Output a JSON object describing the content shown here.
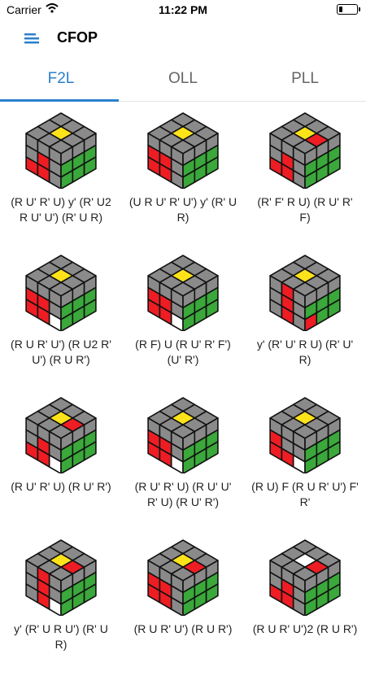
{
  "status": {
    "carrier": "Carrier",
    "time": "11:22 PM"
  },
  "header": {
    "title": "CFOP"
  },
  "tabs": [
    {
      "label": "F2L"
    },
    {
      "label": "OLL"
    },
    {
      "label": "PLL"
    }
  ],
  "colors": {
    "accent": "#2b7fcc",
    "gray": "#8a8a8a",
    "red": "#ee1d23",
    "green": "#3aa83a",
    "yellow": "#ffe31a",
    "white": "#ffffff"
  },
  "cards": [
    {
      "alg": "(R U' R' U) y' (R' U2 R U' U') (R' U R)",
      "cube": {
        "top": [
          "g",
          "g",
          "g",
          "g",
          "y",
          "g",
          "g",
          "g",
          "g"
        ],
        "left": [
          "g",
          "g",
          "g",
          "g",
          "r",
          "g",
          "r",
          "r",
          "g"
        ],
        "right": [
          "g",
          "g",
          "g",
          "g",
          "g",
          "g",
          "g",
          "g",
          "g"
        ]
      }
    },
    {
      "alg": "(U R U' R' U') y' (R' U R)",
      "cube": {
        "top": [
          "g",
          "g",
          "g",
          "g",
          "y",
          "g",
          "g",
          "g",
          "g"
        ],
        "left": [
          "g",
          "g",
          "g",
          "r",
          "r",
          "g",
          "r",
          "r",
          "g"
        ],
        "right": [
          "g",
          "g",
          "g",
          "g",
          "g",
          "g",
          "g",
          "g",
          "g"
        ]
      }
    },
    {
      "alg": "(R' F' R U) (R U' R' F)",
      "cube": {
        "top": [
          "g",
          "g",
          "g",
          "g",
          "y",
          "r",
          "g",
          "g",
          "g"
        ],
        "left": [
          "g",
          "g",
          "g",
          "g",
          "r",
          "g",
          "r",
          "r",
          "g"
        ],
        "right": [
          "g",
          "g",
          "g",
          "g",
          "g",
          "g",
          "g",
          "g",
          "g"
        ]
      }
    },
    {
      "alg": "(R U R' U') (R U2 R' U') (R U R')",
      "cube": {
        "top": [
          "g",
          "g",
          "g",
          "g",
          "y",
          "g",
          "g",
          "g",
          "g"
        ],
        "left": [
          "g",
          "g",
          "g",
          "r",
          "r",
          "g",
          "r",
          "r",
          "w"
        ],
        "right": [
          "g",
          "g",
          "g",
          "g",
          "g",
          "g",
          "g",
          "g",
          "g"
        ]
      }
    },
    {
      "alg": "(R F) U (R U' R' F') (U' R')",
      "cube": {
        "top": [
          "g",
          "g",
          "g",
          "g",
          "y",
          "g",
          "g",
          "g",
          "g"
        ],
        "left": [
          "g",
          "g",
          "g",
          "r",
          "r",
          "g",
          "r",
          "r",
          "w"
        ],
        "right": [
          "g",
          "g",
          "g",
          "g",
          "g",
          "g",
          "g",
          "g",
          "g"
        ]
      }
    },
    {
      "alg": "y' (R' U' R U) (R' U' R)",
      "cube": {
        "top": [
          "g",
          "g",
          "g",
          "g",
          "y",
          "g",
          "g",
          "g",
          "g"
        ],
        "left": [
          "g",
          "r",
          "g",
          "g",
          "r",
          "g",
          "g",
          "r",
          "g"
        ],
        "right": [
          "g",
          "g",
          "g",
          "g",
          "g",
          "g",
          "r",
          "g",
          "g"
        ]
      }
    },
    {
      "alg": "(R U' R' U) (R U' R')",
      "cube": {
        "top": [
          "g",
          "g",
          "g",
          "g",
          "y",
          "r",
          "g",
          "g",
          "g"
        ],
        "left": [
          "g",
          "g",
          "g",
          "g",
          "r",
          "g",
          "r",
          "r",
          "w"
        ],
        "right": [
          "g",
          "g",
          "g",
          "g",
          "g",
          "g",
          "g",
          "g",
          "g"
        ]
      }
    },
    {
      "alg": "(R U' R' U) (R U' U' R' U) (R U' R')",
      "cube": {
        "top": [
          "g",
          "g",
          "g",
          "g",
          "y",
          "g",
          "g",
          "g",
          "g"
        ],
        "left": [
          "g",
          "g",
          "g",
          "r",
          "r",
          "g",
          "r",
          "r",
          "w"
        ],
        "right": [
          "g",
          "g",
          "g",
          "g",
          "g",
          "g",
          "g",
          "g",
          "g"
        ]
      }
    },
    {
      "alg": "(R U) F (R U R' U') F' R'",
      "cube": {
        "top": [
          "g",
          "g",
          "g",
          "g",
          "y",
          "g",
          "g",
          "g",
          "g"
        ],
        "left": [
          "g",
          "g",
          "g",
          "r",
          "g",
          "g",
          "r",
          "r",
          "w"
        ],
        "right": [
          "g",
          "g",
          "g",
          "g",
          "g",
          "g",
          "g",
          "g",
          "g"
        ]
      }
    },
    {
      "alg": "y' (R' U R U') (R' U R)",
      "cube": {
        "top": [
          "g",
          "g",
          "g",
          "g",
          "y",
          "r",
          "g",
          "g",
          "g"
        ],
        "left": [
          "g",
          "r",
          "g",
          "g",
          "r",
          "g",
          "g",
          "r",
          "w"
        ],
        "right": [
          "g",
          "g",
          "g",
          "g",
          "g",
          "g",
          "g",
          "g",
          "g"
        ]
      }
    },
    {
      "alg": "(R U R' U') (R U R')",
      "cube": {
        "top": [
          "g",
          "g",
          "g",
          "g",
          "y",
          "r",
          "g",
          "g",
          "g"
        ],
        "left": [
          "g",
          "g",
          "g",
          "r",
          "r",
          "g",
          "r",
          "r",
          "g"
        ],
        "right": [
          "g",
          "g",
          "g",
          "g",
          "g",
          "g",
          "g",
          "g",
          "g"
        ]
      }
    },
    {
      "alg": "(R U R' U')2 (R U R')",
      "cube": {
        "top": [
          "g",
          "g",
          "g",
          "g",
          "w",
          "r",
          "g",
          "g",
          "g"
        ],
        "left": [
          "g",
          "g",
          "g",
          "g",
          "r",
          "g",
          "r",
          "r",
          "g"
        ],
        "right": [
          "g",
          "g",
          "g",
          "g",
          "g",
          "g",
          "g",
          "g",
          "g"
        ]
      }
    }
  ]
}
